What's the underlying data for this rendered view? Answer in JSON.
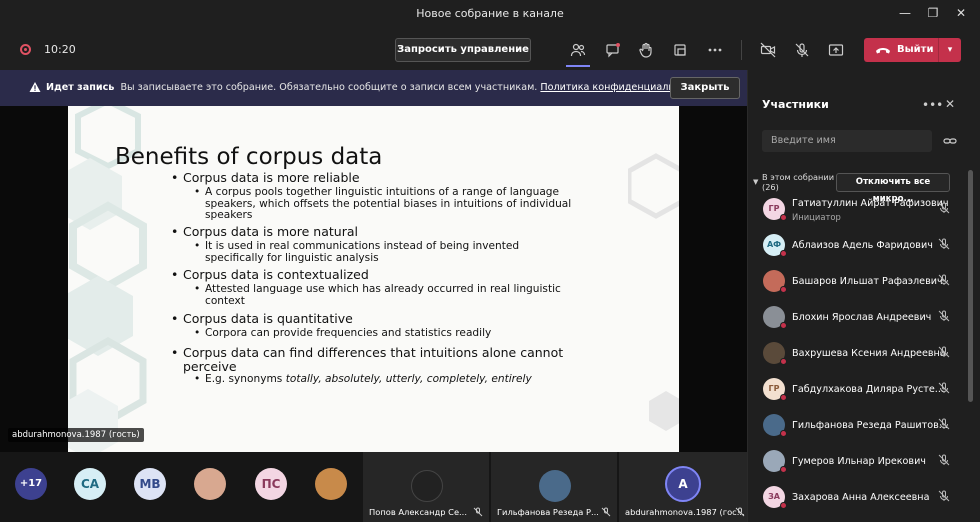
{
  "window": {
    "title": "Новое собрание в канале"
  },
  "toolbar": {
    "timer": "10:20",
    "request_control_label": "Запросить управление",
    "leave_label": "Выйти"
  },
  "banner": {
    "bold": "Идет запись",
    "text": "Вы записываете это собрание. Обязательно сообщите о записи всем участникам.",
    "link": "Политика конфиденциальности",
    "close_label": "Закрыть"
  },
  "slide": {
    "title": "Benefits of corpus data",
    "bullets": [
      {
        "text": "Corpus data is more reliable",
        "sub": "A corpus pools together linguistic intuitions of a range of language speakers, which offsets the potential biases in intuitions of individual speakers"
      },
      {
        "text": "Corpus data is more natural",
        "sub": "It is used in real communications instead of being invented specifically for linguistic analysis"
      },
      {
        "text": "Corpus data is contextualized",
        "sub": "Attested language use which has already occurred in real linguistic context"
      },
      {
        "text": "Corpus data is quantitative",
        "sub": "Corpora can provide frequencies and statistics readily"
      },
      {
        "text": "Corpus data can find differences that intuitions alone cannot perceive",
        "sub_prefix": "E.g. synonyms",
        "sub_italic": "totally, absolutely, utterly, completely, entirely"
      }
    ]
  },
  "presenter_chip": "abdurahmonova.1987 (гость)",
  "gallery": {
    "overflow": "+17",
    "avatars": [
      "СА",
      "МВ",
      "ПС"
    ],
    "tiles": [
      "Попов Александр Се...",
      "Гильфанова Резеда Р...",
      "abdurahmonova.1987 (гос..."
    ],
    "self_initial": "А"
  },
  "participants_panel": {
    "title": "Участники",
    "search_placeholder": "Введите имя",
    "section_label": "В этом собрании",
    "section_count": "(26)",
    "mute_all_label": "Отключить все микро...",
    "people": [
      {
        "initials": "ГР",
        "name": "Гатиатуллин Айрат Рафизович",
        "role": "Инициатор",
        "color": "#f3d6e3",
        "fg": "#8a3a5c"
      },
      {
        "initials": "АФ",
        "name": "Аблаизов Адель Фаридович",
        "color": "#d6eef5",
        "fg": "#1f6a82"
      },
      {
        "initials": "",
        "name": "Башаров Ильшат Рафаэлевич",
        "color": "#c46b5a",
        "fg": "#fff"
      },
      {
        "initials": "",
        "name": "Блохин Ярослав Андреевич",
        "color": "#8a8f96",
        "fg": "#fff"
      },
      {
        "initials": "",
        "name": "Вахрушева Ксения Андреевна",
        "color": "#5a4a3a",
        "fg": "#fff"
      },
      {
        "initials": "ГР",
        "name": "Габдулхакова Диляра Русте...",
        "color": "#f3e0d0",
        "fg": "#8a5a3a"
      },
      {
        "initials": "",
        "name": "Гильфанова Резеда Рашитов...",
        "color": "#4a6a8a",
        "fg": "#fff"
      },
      {
        "initials": "",
        "name": "Гумеров Ильнар Ирекович",
        "color": "#9aa8b8",
        "fg": "#fff"
      },
      {
        "initials": "ЗА",
        "name": "Захарова Анна Алексеевна",
        "color": "#f3d6e3",
        "fg": "#8a3a5c"
      }
    ]
  }
}
